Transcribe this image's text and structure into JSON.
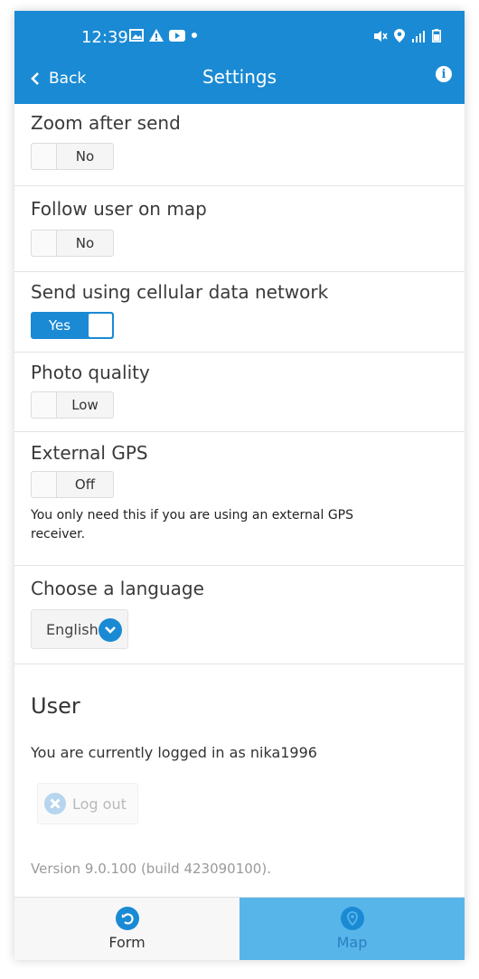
{
  "status_bar": {
    "time": "12:39"
  },
  "header": {
    "back_label": "Back",
    "title": "Settings"
  },
  "settings": {
    "zoom_after_send": {
      "label": "Zoom after send",
      "value": "No",
      "on": false
    },
    "follow_user": {
      "label": "Follow user on map",
      "value": "No",
      "on": false
    },
    "cellular": {
      "label": "Send using cellular data network",
      "value": "Yes",
      "on": true
    },
    "photo_quality": {
      "label": "Photo quality",
      "value": "Low",
      "on": false
    },
    "external_gps": {
      "label": "External GPS",
      "value": "Off",
      "on": false,
      "help": "You only need this if you are using an external GPS receiver."
    },
    "language": {
      "label": "Choose a language",
      "value": "English"
    }
  },
  "user": {
    "heading": "User",
    "logged_in_text": "You are currently logged in as nika1996",
    "logout_label": "Log out"
  },
  "version": "Version 9.0.100 (build 423090100).",
  "tabs": {
    "form_label": "Form",
    "map_label": "Map"
  },
  "colors": {
    "primary": "#1a8ad4",
    "active_tab": "#58b5ea"
  }
}
